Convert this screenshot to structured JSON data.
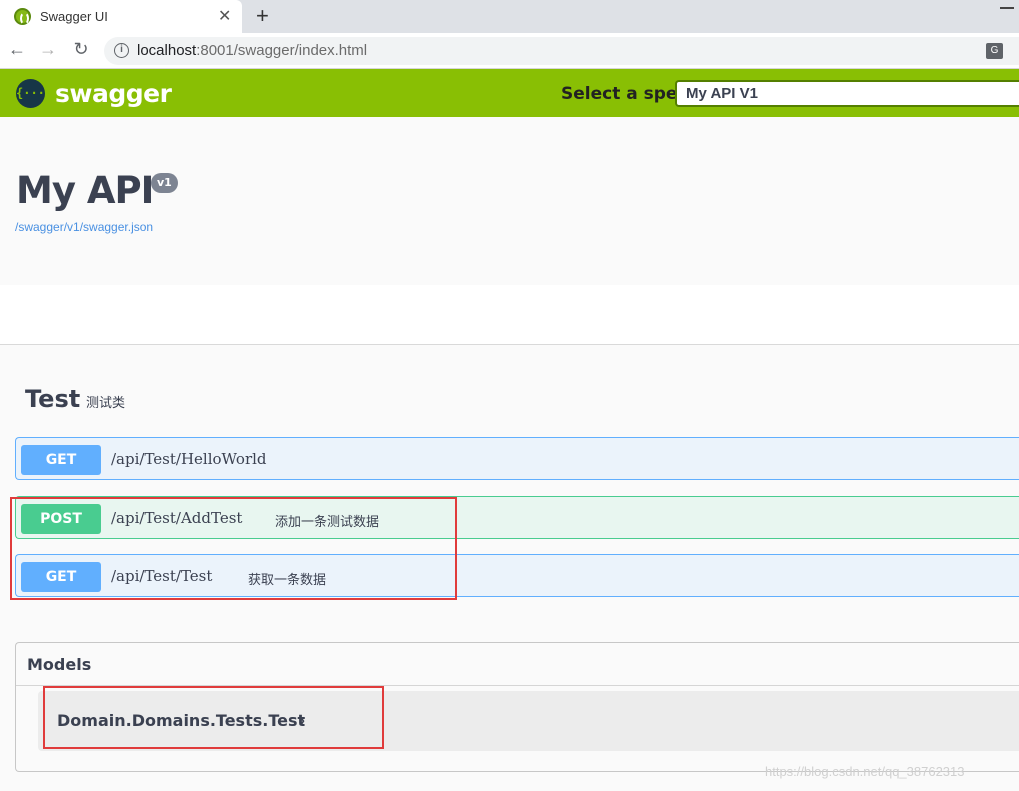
{
  "browser": {
    "tab_title": "Swagger UI",
    "tab_close": "✕",
    "new_tab": "+",
    "url_host": "localhost",
    "url_rest": ":8001/swagger/index.html"
  },
  "topbar": {
    "logo_symbol": "{···}",
    "logo_text": "swagger",
    "spec_label": "Select a spec",
    "spec_value": "My API V1",
    "color": "#89bf04"
  },
  "info": {
    "title": "My API",
    "version": "v1",
    "spec_link": "/swagger/v1/swagger.json"
  },
  "tag": {
    "name": "Test",
    "description": "测试类"
  },
  "operations": [
    {
      "method": "GET",
      "path": "/api/Test/HelloWorld",
      "summary": ""
    },
    {
      "method": "POST",
      "path": "/api/Test/AddTest",
      "summary": "添加一条测试数据"
    },
    {
      "method": "GET",
      "path": "/api/Test/Test",
      "summary": "获取一条数据"
    }
  ],
  "models": {
    "title": "Models",
    "items": [
      {
        "name": "Domain.Domains.Tests.Test",
        "chevron": "›"
      }
    ]
  },
  "watermark": "https://blog.csdn.net/qq_38762313"
}
